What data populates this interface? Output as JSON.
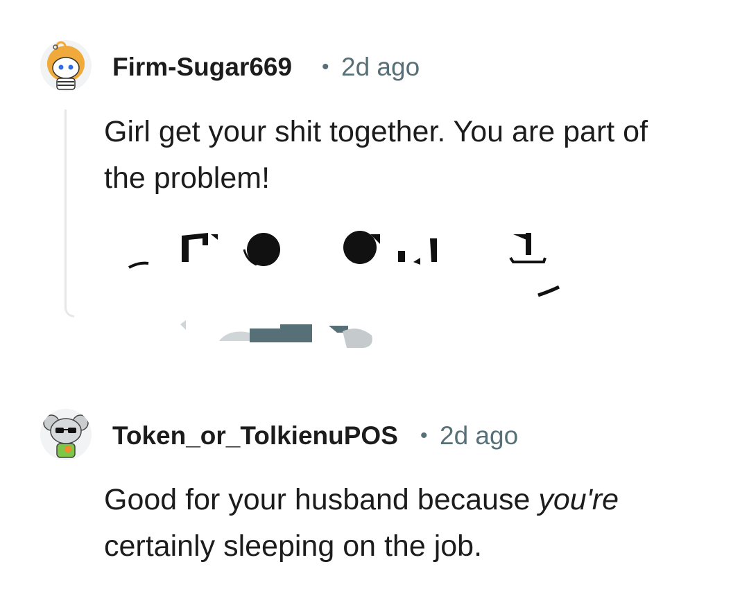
{
  "comments": [
    {
      "username": "Firm-Sugar669",
      "separator": "•",
      "timestamp": "2d ago",
      "body_lines": [
        "Girl get your shit together. You are part of",
        "the problem!"
      ]
    },
    {
      "username": "Token_or_TolkienuPOS",
      "separator": "•",
      "timestamp": "2d ago",
      "body_before_emphasis": "Good for your husband because ",
      "body_emphasis": "you're",
      "body_line2": "certainly sleeping on the job."
    }
  ],
  "colors": {
    "text": "#1c1c1c",
    "meta": "#576f76",
    "thread_line": "#e5e7e9",
    "avatar_bg": "#f2f3f4",
    "snoo_hair": "#f0a93b",
    "snoo_shirt_green": "#7ec648"
  },
  "icons": {
    "avatar_1": "snoo-avatar-orange-hair-icon",
    "avatar_2": "snoo-avatar-koala-sunglasses-icon"
  }
}
